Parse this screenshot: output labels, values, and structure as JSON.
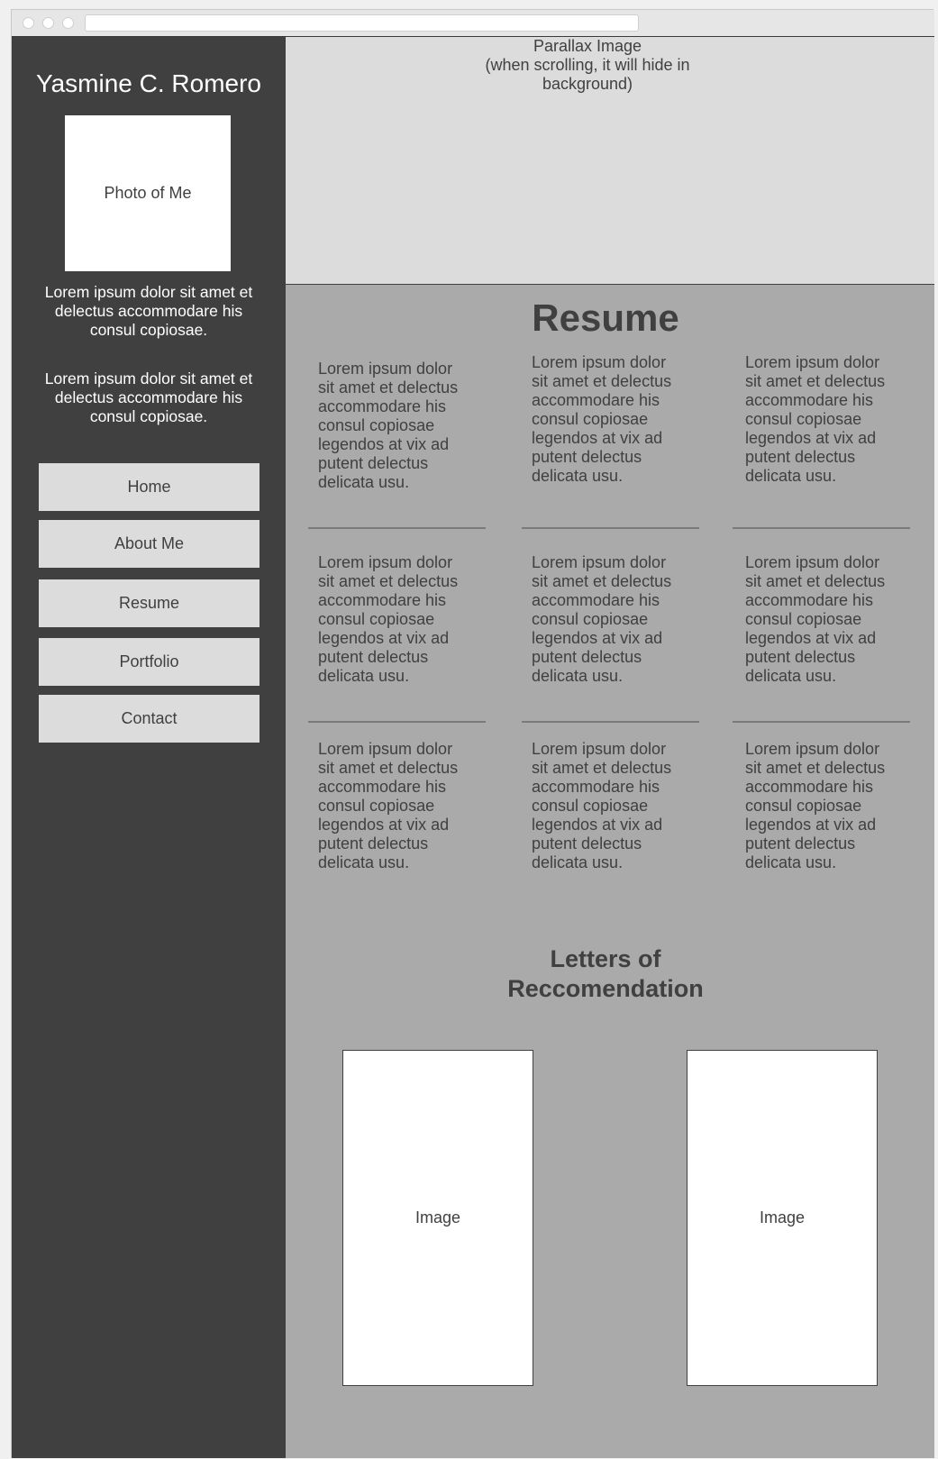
{
  "sidebar": {
    "name": "Yasmine C. Romero",
    "photo_label": "Photo of Me",
    "bio": [
      "Lorem ipsum dolor sit amet et delectus accommodare his consul copiosae.",
      "Lorem ipsum dolor sit amet et delectus accommodare his consul copiosae."
    ],
    "nav": [
      {
        "label": "Home"
      },
      {
        "label": "About Me"
      },
      {
        "label": "Resume"
      },
      {
        "label": "Portfolio"
      },
      {
        "label": "Contact"
      }
    ]
  },
  "main": {
    "parallax": {
      "line1": "Parallax Image",
      "line2": "(when scrolling, it will hide in background)"
    },
    "resume": {
      "title": "Resume",
      "items": [
        "Lorem ipsum dolor sit amet et delectus accommodare his consul copiosae legendos at vix ad putent delectus delicata usu.",
        "Lorem ipsum dolor sit amet et delectus accommodare his consul copiosae legendos at vix ad putent delectus delicata usu.",
        "Lorem ipsum dolor sit amet et delectus accommodare his consul copiosae legendos at vix ad putent delectus delicata usu.",
        "Lorem ipsum dolor sit amet et delectus accommodare his consul copiosae legendos at vix ad putent delectus delicata usu.",
        "Lorem ipsum dolor sit amet et delectus accommodare his consul copiosae legendos at vix ad putent delectus delicata usu.",
        "Lorem ipsum dolor sit amet et delectus accommodare his consul copiosae legendos at vix ad putent delectus delicata usu.",
        "Lorem ipsum dolor sit amet et delectus accommodare his consul copiosae legendos at vix ad putent delectus delicata usu.",
        "Lorem ipsum dolor sit amet et delectus accommodare his consul copiosae legendos at vix ad putent delectus delicata usu.",
        "Lorem ipsum dolor sit amet et delectus accommodare his consul copiosae legendos at vix ad putent delectus delicata usu."
      ]
    },
    "letters": {
      "title": "Letters of Reccomendation",
      "images": [
        {
          "label": "Image"
        },
        {
          "label": "Image"
        }
      ]
    }
  },
  "colors": {
    "sidebar_bg": "#404040",
    "main_bg": "#aaaaaa",
    "parallax_bg": "#dcdcdc",
    "button_bg": "#dcdcdc",
    "text_dark": "#404040"
  }
}
